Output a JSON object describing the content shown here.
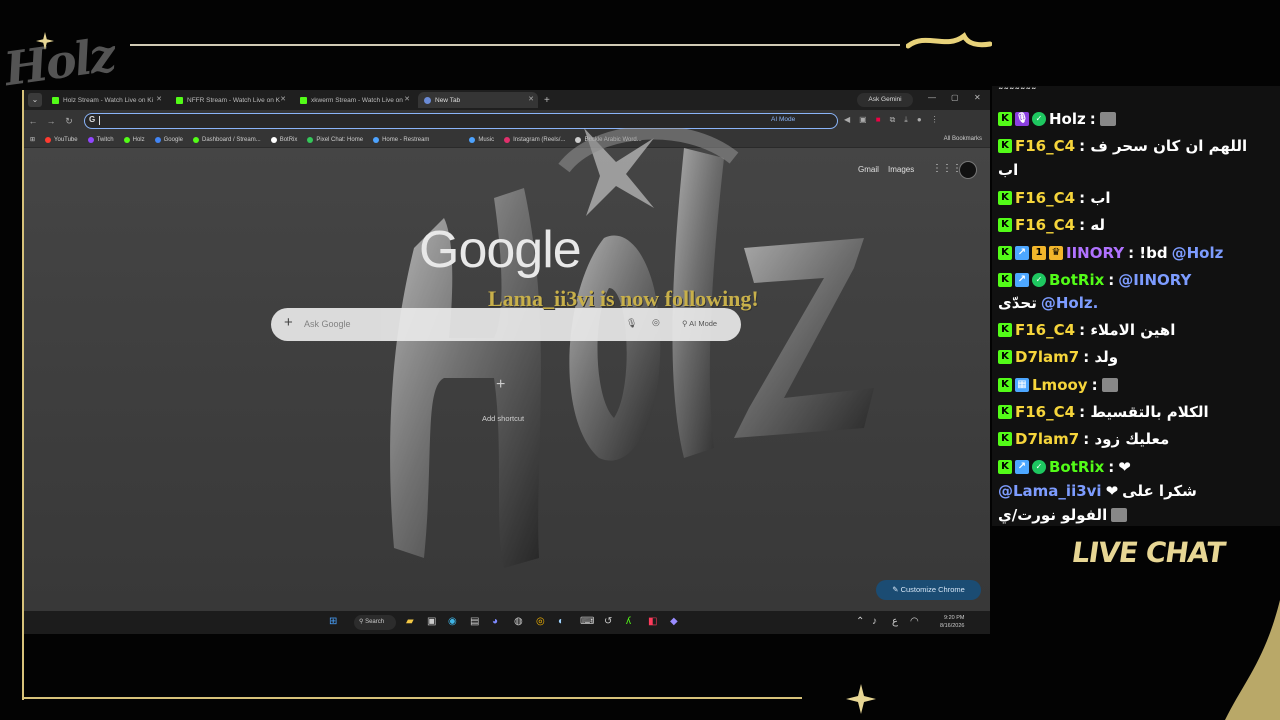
{
  "overlay": {
    "brand_logo": "Holz",
    "live_chat_label": "LIVE CHAT",
    "follow_alert": "Lama_ii3vi is now following!"
  },
  "browser": {
    "tabs": [
      {
        "label": "Holz Stream - Watch Live on Ki",
        "favicon": "kick-icon"
      },
      {
        "label": "NFFR Stream - Watch Live on K",
        "favicon": "kick-icon"
      },
      {
        "label": "xkwerm Stream - Watch Live on",
        "favicon": "kick-icon"
      },
      {
        "label": "New Tab",
        "favicon": "chrome-icon",
        "active": true
      }
    ],
    "ask_gemini": "Ask Gemini",
    "omnibox_ai_mode": "AI Mode",
    "bookmarks": [
      {
        "label": "YouTube",
        "color": "#ff3b30"
      },
      {
        "label": "Twitch",
        "color": "#9146ff"
      },
      {
        "label": "Holz",
        "color": "#53fc18"
      },
      {
        "label": "Google",
        "color": "#4285f4"
      },
      {
        "label": "Dashboard / Stream...",
        "color": "#53fc18"
      },
      {
        "label": "BotRix",
        "color": "#ffffff"
      },
      {
        "label": "Pixel Chat: Home",
        "color": "#34c759"
      },
      {
        "label": "Home - Restream",
        "color": "#4da3ff"
      },
      {
        "label": "Music",
        "color": "#4da3ff"
      },
      {
        "label": "Instagram (Reels/...",
        "color": "#e1306c"
      },
      {
        "label": "Buckle Arabic Word...",
        "color": "#cccccc"
      }
    ],
    "all_bookmarks": "All Bookmarks"
  },
  "newtab": {
    "gmail": "Gmail",
    "images": "Images",
    "logo": "Google",
    "search_placeholder": "Ask Google",
    "search_ai_mode": "AI Mode",
    "add_shortcut": "Add shortcut",
    "customize": "Customize Chrome"
  },
  "taskbar": {
    "search": "Search",
    "time": "9:20 PM",
    "date": "8/16/2026"
  },
  "chat": {
    "messages": [
      {
        "user": "Holz",
        "user_class": "user-p",
        "badges": [
          "kick",
          "mic",
          "ver"
        ],
        "text": ":",
        "emote": true
      },
      {
        "user": "F16_C4",
        "user_class": "user-y",
        "badges": [
          "kick"
        ],
        "text": ": اللهم ان كان سحر ف",
        "cont": "اب"
      },
      {
        "user": "F16_C4",
        "user_class": "user-y",
        "badges": [
          "kick"
        ],
        "text": ": اب"
      },
      {
        "user": "F16_C4",
        "user_class": "user-y",
        "badges": [
          "kick"
        ],
        "text": ": له"
      },
      {
        "user": "IINORY",
        "user_class": "user-p",
        "badges": [
          "kick",
          "sub",
          "gold",
          "crown"
        ],
        "text": ": !bd",
        "mention": "@Holz"
      },
      {
        "user": "BotRix",
        "user_class": "user-g",
        "badges": [
          "kick",
          "sub",
          "ver"
        ],
        "text": ":",
        "mention": "@IINORY",
        "cont_mention": "@Holz.",
        "cont": "تحدّى"
      },
      {
        "user": "F16_C4",
        "user_class": "user-y",
        "badges": [
          "kick"
        ],
        "text": ": اهين الاملاء"
      },
      {
        "user": "D7lam7",
        "user_class": "user-y",
        "badges": [
          "kick"
        ],
        "text": ": ولد"
      },
      {
        "user": "Lmooy",
        "user_class": "user-y",
        "badges": [
          "kick",
          "sub"
        ],
        "text": ":",
        "emote": true
      },
      {
        "user": "F16_C4",
        "user_class": "user-y",
        "badges": [
          "kick"
        ],
        "text": ": الكلام بالتقسيط"
      },
      {
        "user": "D7lam7",
        "user_class": "user-y",
        "badges": [
          "kick"
        ],
        "text": ": معليك زود"
      },
      {
        "user": "BotRix",
        "user_class": "user-g",
        "badges": [
          "kick",
          "sub",
          "ver"
        ],
        "text": ":",
        "heart": true,
        "cont_mention": "@Lama_ii3vi",
        "cont": "شكرا على",
        "cont2": "الفولو نورت/ي"
      }
    ]
  }
}
